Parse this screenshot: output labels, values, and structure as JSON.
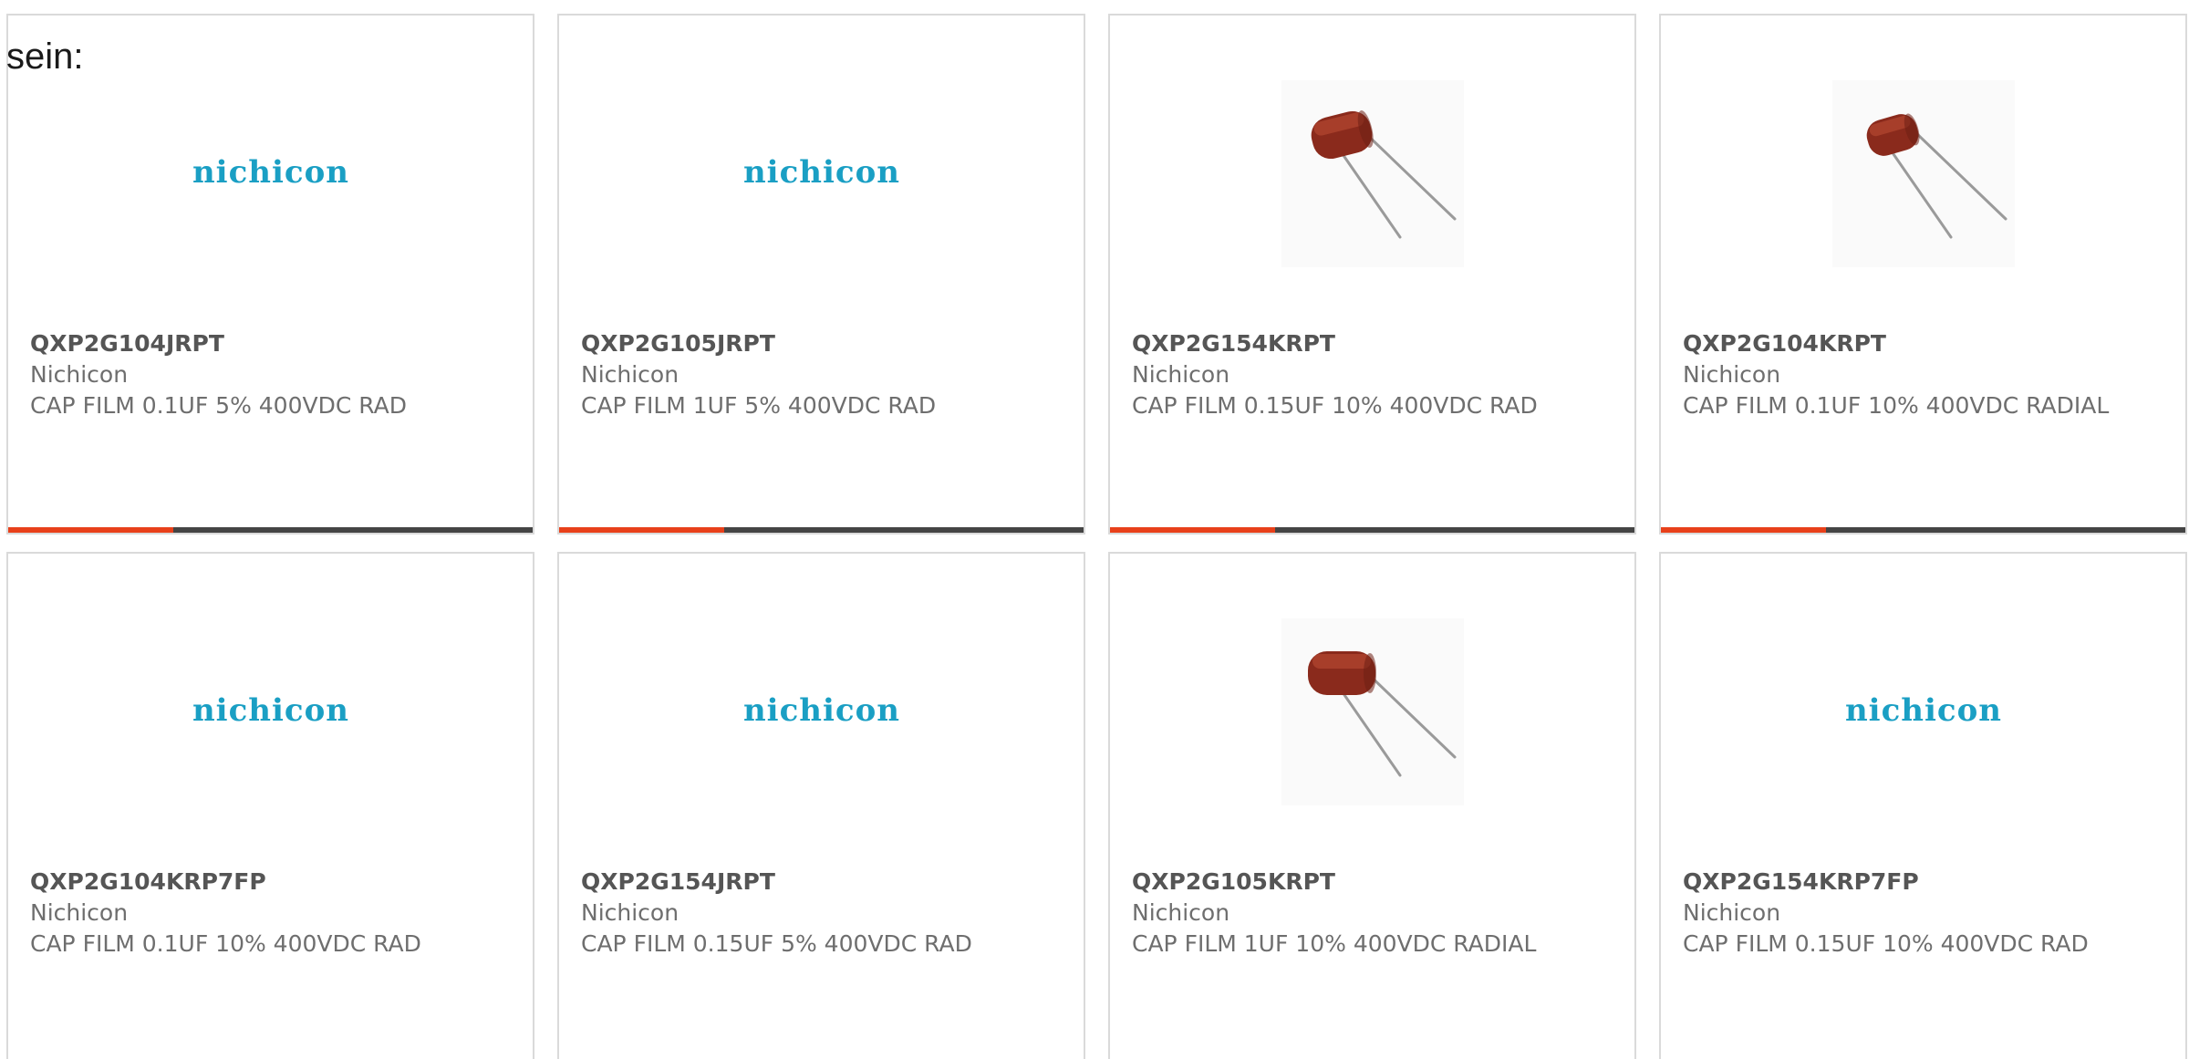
{
  "intro_text": "sein:",
  "colors": {
    "accent": "#e8401a",
    "bar": "#444444",
    "logo": "#1a9fc4"
  },
  "products": [
    {
      "part_number": "QXP2G104JRPT",
      "manufacturer": "Nichicon",
      "description": "CAP FILM 0.1UF 5% 400VDC RAD",
      "image": "nichicon-logo",
      "logo_text": "nichicon"
    },
    {
      "part_number": "QXP2G105JRPT",
      "manufacturer": "Nichicon",
      "description": "CAP FILM 1UF 5% 400VDC RAD",
      "image": "nichicon-logo",
      "logo_text": "nichicon"
    },
    {
      "part_number": "QXP2G154KRPT",
      "manufacturer": "Nichicon",
      "description": "CAP FILM 0.15UF 10% 400VDC RAD",
      "image": "film-capacitor-photo"
    },
    {
      "part_number": "QXP2G104KRPT",
      "manufacturer": "Nichicon",
      "description": "CAP FILM 0.1UF 10% 400VDC RADIAL",
      "image": "film-capacitor-photo"
    },
    {
      "part_number": "QXP2G104KRP7FP",
      "manufacturer": "Nichicon",
      "description": "CAP FILM 0.1UF 10% 400VDC RAD",
      "image": "nichicon-logo",
      "logo_text": "nichicon"
    },
    {
      "part_number": "QXP2G154JRPT",
      "manufacturer": "Nichicon",
      "description": "CAP FILM 0.15UF 5% 400VDC RAD",
      "image": "nichicon-logo",
      "logo_text": "nichicon"
    },
    {
      "part_number": "QXP2G105KRPT",
      "manufacturer": "Nichicon",
      "description": "CAP FILM 1UF 10% 400VDC RADIAL",
      "image": "film-capacitor-photo"
    },
    {
      "part_number": "QXP2G154KRP7FP",
      "manufacturer": "Nichicon",
      "description": "CAP FILM 0.15UF 10% 400VDC RAD",
      "image": "nichicon-logo",
      "logo_text": "nichicon"
    }
  ]
}
